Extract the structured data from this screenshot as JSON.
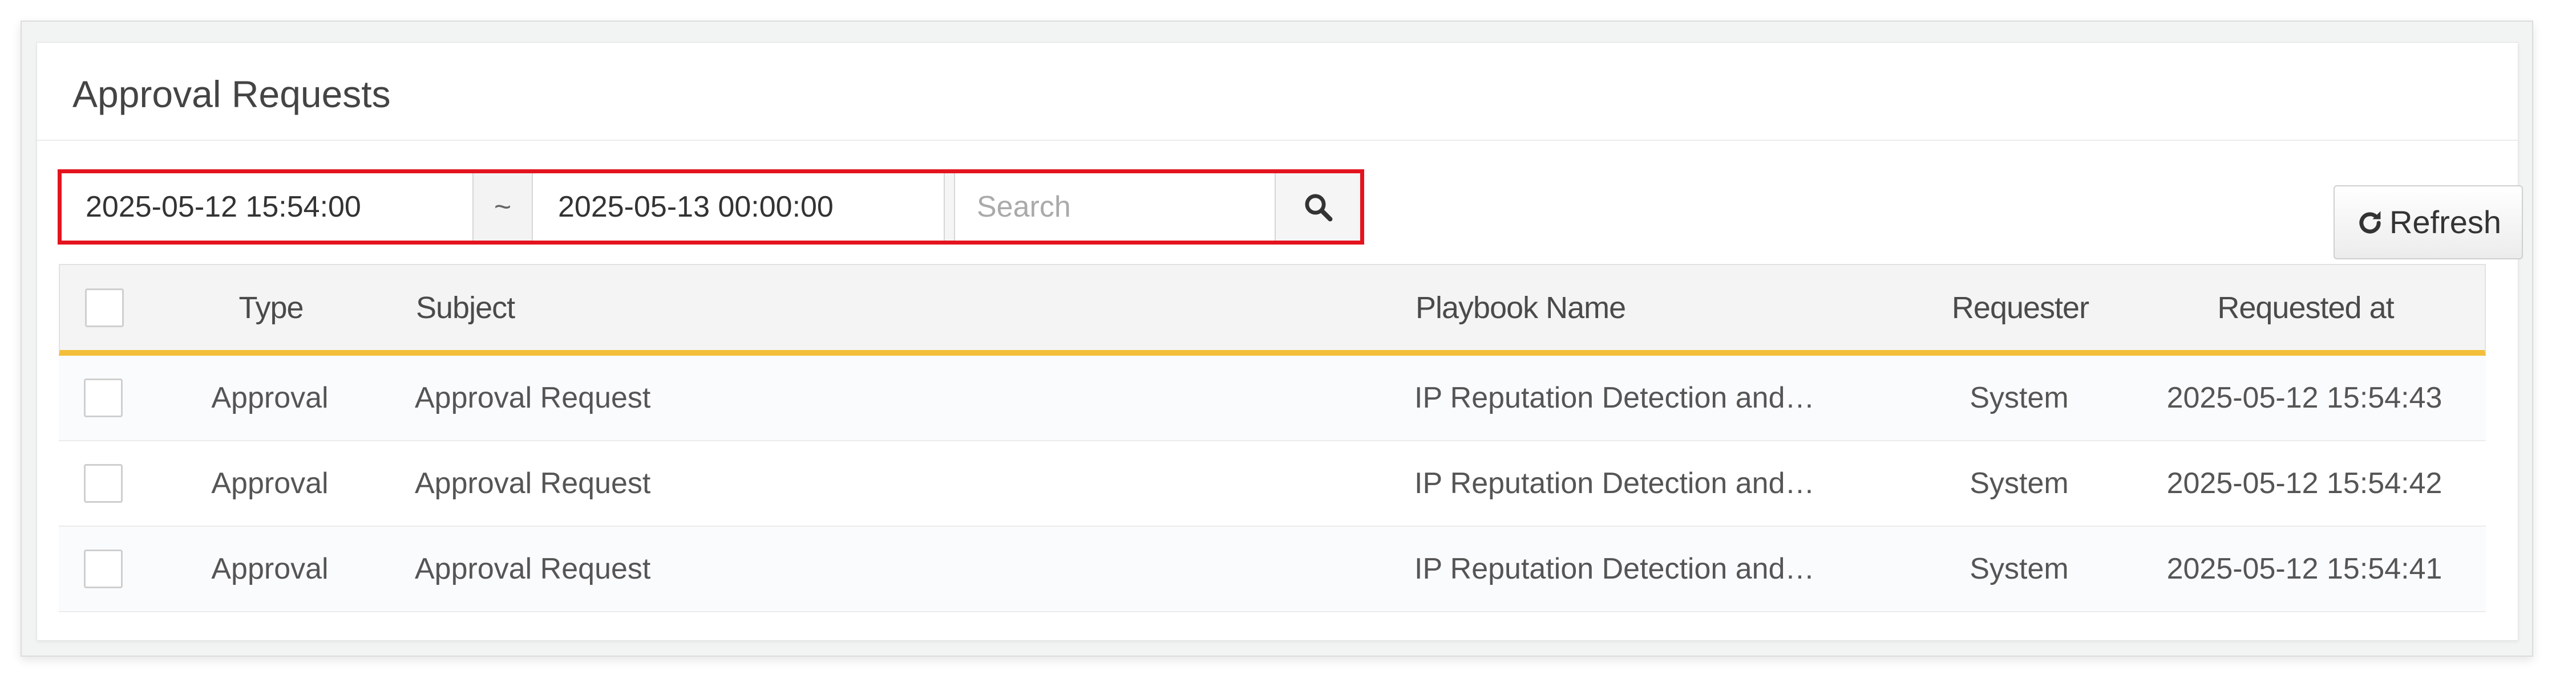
{
  "panel": {
    "title": "Approval Requests"
  },
  "filters": {
    "start_date": "2025-05-12 15:54:00",
    "separator": "~",
    "end_date": "2025-05-13 00:00:00",
    "search_placeholder": "Search"
  },
  "toolbar": {
    "refresh_label": "Refresh"
  },
  "table": {
    "columns": [
      "Type",
      "Subject",
      "Playbook Name",
      "Requester",
      "Requested at"
    ],
    "rows": [
      {
        "type": "Approval",
        "subject": "Approval Request",
        "playbook": "IP Reputation Detection and…",
        "requester": "System",
        "requested_at": "2025-05-12 15:54:43"
      },
      {
        "type": "Approval",
        "subject": "Approval Request",
        "playbook": "IP Reputation Detection and…",
        "requester": "System",
        "requested_at": "2025-05-12 15:54:42"
      },
      {
        "type": "Approval",
        "subject": "Approval Request",
        "playbook": "IP Reputation Detection and…",
        "requester": "System",
        "requested_at": "2025-05-12 15:54:41"
      }
    ]
  },
  "colors": {
    "highlight_border": "#e3141e",
    "header_accent": "#f3bf3a"
  }
}
